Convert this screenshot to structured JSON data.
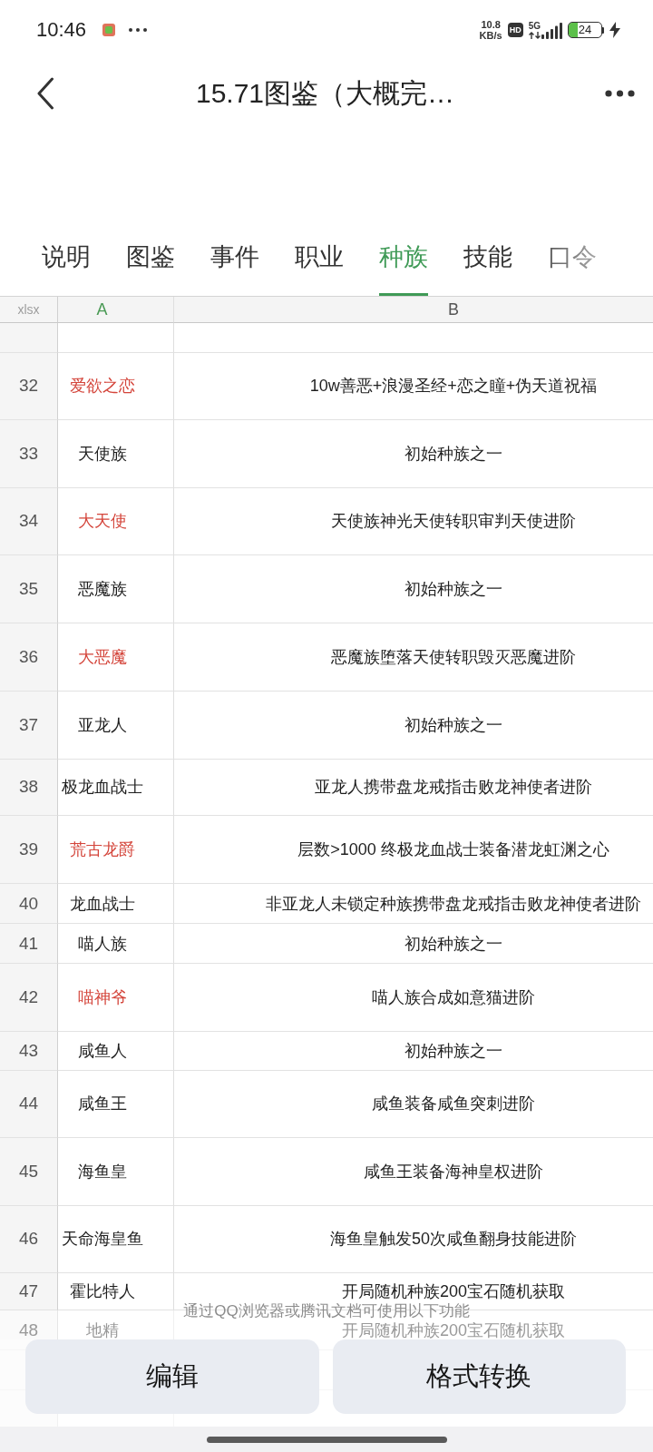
{
  "status_bar": {
    "time": "10:46",
    "speed_value": "10.8",
    "speed_unit": "KB/s",
    "hd_badge": "HD",
    "network_type": "5G",
    "battery": "24"
  },
  "header": {
    "title": "15.71图鉴（大概完…"
  },
  "tabs": [
    {
      "label": "说明",
      "selected": false
    },
    {
      "label": "图鉴",
      "selected": false
    },
    {
      "label": "事件",
      "selected": false
    },
    {
      "label": "职业",
      "selected": false
    },
    {
      "label": "种族",
      "selected": true
    },
    {
      "label": "技能",
      "selected": false
    },
    {
      "label": "口令",
      "selected": false
    }
  ],
  "sheet": {
    "corner_label": "xlsx",
    "columns": [
      {
        "label": "A",
        "selected": true
      },
      {
        "label": "B",
        "selected": false
      }
    ],
    "rows": [
      {
        "number": "32",
        "name": "爱欲之恋",
        "color": "#d4453b",
        "description": "10w善恶+浪漫圣经+恋之瞳+伪天道祝福",
        "dimmed": false
      },
      {
        "number": "33",
        "name": "天使族",
        "color": "#1f1f1f",
        "description": "初始种族之一",
        "dimmed": false
      },
      {
        "number": "34",
        "name": "大天使",
        "color": "#d4453b",
        "description": "天使族神光天使转职审判天使进阶",
        "dimmed": false
      },
      {
        "number": "35",
        "name": "恶魔族",
        "color": "#1f1f1f",
        "description": "初始种族之一",
        "dimmed": false
      },
      {
        "number": "36",
        "name": "大恶魔",
        "color": "#d4453b",
        "description": "恶魔族堕落天使转职毁灭恶魔进阶",
        "dimmed": false
      },
      {
        "number": "37",
        "name": "亚龙人",
        "color": "#1f1f1f",
        "description": "初始种族之一",
        "dimmed": false
      },
      {
        "number": "38",
        "name": "极龙血战士",
        "color": "#1f1f1f",
        "description": "亚龙人携带盘龙戒指击败龙神使者进阶",
        "dimmed": false
      },
      {
        "number": "39",
        "name": "荒古龙爵",
        "color": "#d4453b",
        "description": "层数>1000 终极龙血战士装备潜龙虹渊之心",
        "dimmed": false
      },
      {
        "number": "40",
        "name": "龙血战士",
        "color": "#1f1f1f",
        "description": "非亚龙人未锁定种族携带盘龙戒指击败龙神使者进阶",
        "dimmed": false
      },
      {
        "number": "41",
        "name": "喵人族",
        "color": "#1f1f1f",
        "description": "初始种族之一",
        "dimmed": false
      },
      {
        "number": "42",
        "name": "喵神爷",
        "color": "#d4453b",
        "description": "喵人族合成如意猫进阶",
        "dimmed": false
      },
      {
        "number": "43",
        "name": "咸鱼人",
        "color": "#1f1f1f",
        "description": "初始种族之一",
        "dimmed": false
      },
      {
        "number": "44",
        "name": "咸鱼王",
        "color": "#1f1f1f",
        "description": "咸鱼装备咸鱼突刺进阶",
        "dimmed": false
      },
      {
        "number": "45",
        "name": "海鱼皇",
        "color": "#1f1f1f",
        "description": "咸鱼王装备海神皇权进阶",
        "dimmed": false
      },
      {
        "number": "46",
        "name": "天命海皇鱼",
        "color": "#1f1f1f",
        "description": "海鱼皇触发50次咸鱼翻身技能进阶",
        "dimmed": false
      },
      {
        "number": "47",
        "name": "霍比特人",
        "color": "#1f1f1f",
        "description": "开局随机种族200宝石随机获取",
        "dimmed": false
      },
      {
        "number": "48",
        "name": "地精",
        "color": "#999999",
        "description": "开局随机种族200宝石随机获取",
        "dimmed": true
      }
    ]
  },
  "action_panel": {
    "hint": "通过QQ浏览器或腾讯文档可使用以下功能",
    "buttons": [
      "编辑",
      "格式转换"
    ]
  }
}
